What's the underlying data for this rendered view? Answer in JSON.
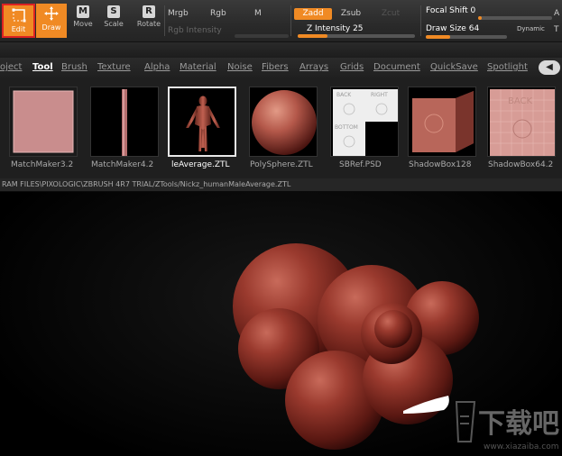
{
  "toolbar": {
    "edit_label": "Edit",
    "draw_label": "Draw",
    "move_label": "Move",
    "move_key": "M",
    "scale_label": "Scale",
    "scale_key": "S",
    "rotate_label": "Rotate",
    "rotate_key": "R",
    "mrgb_label": "Mrgb",
    "rgb_label": "Rgb",
    "m_label": "M",
    "rgb_intensity_label": "Rgb Intensity",
    "zadd_label": "Zadd",
    "zsub_label": "Zsub",
    "zcut_label": "Zcut",
    "z_intensity_label": "Z Intensity",
    "z_intensity_value": "25",
    "focal_shift_label": "Focal Shift",
    "focal_shift_value": "0",
    "draw_size_label": "Draw Size",
    "draw_size_value": "64",
    "dynamic_label": "Dynamic",
    "right_a": "A",
    "right_t": "T",
    "z_intensity_fraction": 0.25,
    "draw_size_fraction": 0.3,
    "focal_shift_fraction": 0.0,
    "accent_color": "#f08a24",
    "highlight_border_color": "#dd2222"
  },
  "menubar": {
    "items": [
      "oject",
      "Tool",
      "Brush",
      "Texture",
      "Alpha",
      "Material",
      "Noise",
      "Fibers",
      "Arrays",
      "Grids",
      "Document",
      "QuickSave",
      "Spotlight"
    ],
    "active_index": 1,
    "left_arrow": "◀"
  },
  "shelf": {
    "items": [
      {
        "label": "MatchMaker3.2"
      },
      {
        "label": "MatchMaker4.2"
      },
      {
        "label": "leAverage.ZTL",
        "selected": true
      },
      {
        "label": "PolySphere.ZTL"
      },
      {
        "label": "SBRef.PSD"
      },
      {
        "label": "ShadowBox128"
      },
      {
        "label": "ShadowBox64.2"
      }
    ],
    "sbref_texts": [
      "BACK",
      "RIGHT",
      "BOTTOM"
    ],
    "shadowbox_text": "BACK",
    "path": "RAM FILES\\PIXOLOGIC\\ZBRUSH 4R7 TRIAL/ZTools/Nickz_humanMaleAverage.ZTL"
  },
  "watermark": {
    "cn_text": "下载吧",
    "url_text": "www.xiazaiba.com"
  }
}
